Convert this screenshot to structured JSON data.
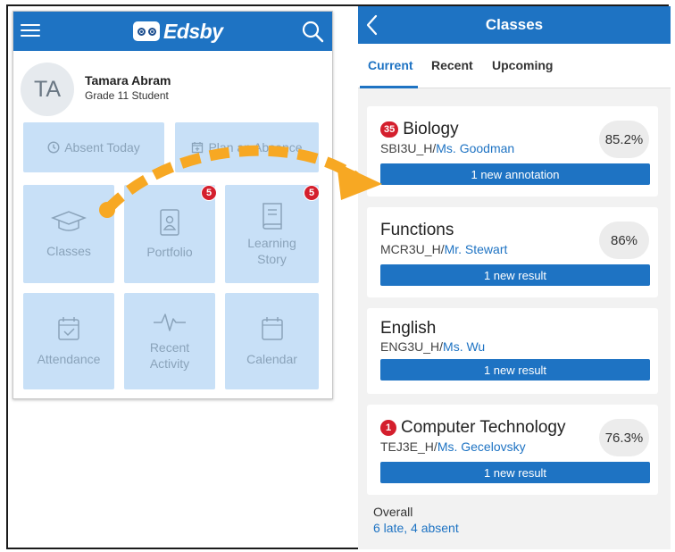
{
  "left_app": {
    "logo_text": "Edsby",
    "user": {
      "initials": "TA",
      "name": "Tamara Abram",
      "role": "Grade 11 Student"
    },
    "actions": [
      {
        "label": "Absent Today",
        "icon": "clock-icon"
      },
      {
        "label": "Plan an Absence",
        "icon": "calendar-plus-icon"
      }
    ],
    "tiles": [
      {
        "label": "Classes",
        "icon": "graduation-cap-icon"
      },
      {
        "label": "Portfolio",
        "icon": "portfolio-icon",
        "badge": "5"
      },
      {
        "label": "Learning",
        "label2": "Story",
        "icon": "book-icon",
        "badge": "5"
      },
      {
        "label": "Attendance",
        "icon": "calendar-check-icon"
      },
      {
        "label": "Recent",
        "label2": "Activity",
        "icon": "pulse-icon"
      },
      {
        "label": "Calendar",
        "icon": "calendar-icon"
      }
    ]
  },
  "right_app": {
    "title": "Classes",
    "tabs": [
      "Current",
      "Recent",
      "Upcoming"
    ],
    "active_tab": "Current",
    "classes": [
      {
        "badge": "35",
        "name": "Biology",
        "code": "SBI3U_H",
        "teacher": "Ms. Goodman",
        "grade": "85.2%",
        "notice": "1 new annotation"
      },
      {
        "badge": "",
        "name": "Functions",
        "code": "MCR3U_H",
        "teacher": "Mr. Stewart",
        "grade": "86%",
        "notice": "1 new result"
      },
      {
        "badge": "",
        "name": "English",
        "code": "ENG3U_H",
        "teacher": "Ms. Wu",
        "grade": "",
        "notice": "1 new result"
      },
      {
        "badge": "1",
        "name": "Computer Technology",
        "code": "TEJ3E_H",
        "teacher": "Ms. Gecelovsky",
        "grade": "76.3%",
        "notice": "1 new result"
      }
    ],
    "code_separator": "/",
    "overall_label": "Overall",
    "overall_value": "6 late, 4 absent"
  },
  "colors": {
    "brand_blue": "#1e73c3",
    "tile_blue": "#c8e0f7",
    "badge_red": "#d41f2d",
    "arrow_orange": "#f7a823"
  }
}
